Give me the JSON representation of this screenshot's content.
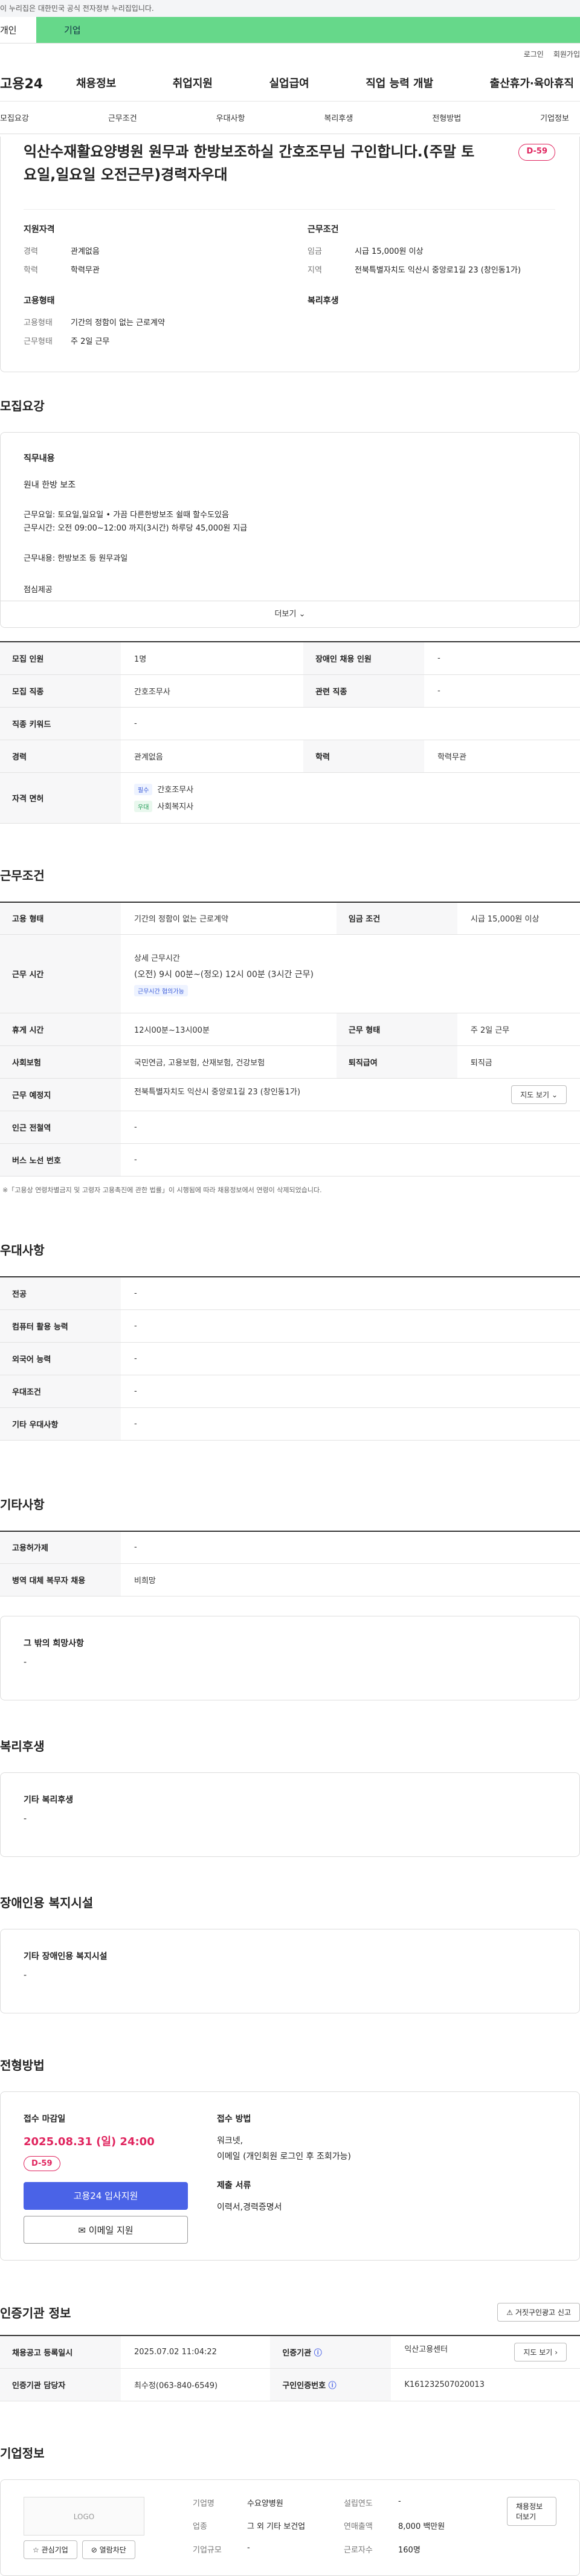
{
  "gov_bar": "이 누리집은 대한민국 공식 전자정부 누리집입니다.",
  "tabs": {
    "person": "개인",
    "company": "기업"
  },
  "util": {
    "login": "로그인",
    "join": "회원가입"
  },
  "logo": "고용24",
  "gnb": [
    "채용정보",
    "취업지원",
    "실업급여",
    "직업 능력 개발",
    "출산휴가·육아휴직"
  ],
  "anchors": [
    "모집요강",
    "근무조건",
    "우대사항",
    "복리후생",
    "전형방법",
    "기업정보"
  ],
  "title": "익산수재활요양병원 원무과 한방보조하실 간호조무님 구인합니다.(주말 토요일,일요일 오전근무)경력자우대",
  "dday": "D-59",
  "summary": {
    "qual_title": "지원자격",
    "qual": [
      {
        "k": "경력",
        "v": "관계없음"
      },
      {
        "k": "학력",
        "v": "학력무관"
      }
    ],
    "cond_title": "근무조건",
    "cond": [
      {
        "k": "임금",
        "v": "시급 15,000원 이상"
      },
      {
        "k": "지역",
        "v": "전북특별자치도 익산시 중앙로1길 23 (창인동1가)"
      }
    ],
    "emp_title": "고용형태",
    "emp": [
      {
        "k": "고용형태",
        "v": "기간의 정함이 없는 근로계약"
      },
      {
        "k": "근무형태",
        "v": "주 2일 근무"
      }
    ],
    "welfare_title": "복리후생"
  },
  "recruit": {
    "section": "모집요강",
    "duty_title": "직무내용",
    "duty_lines": [
      "원내 한방 보조",
      "",
      "근무요일: 토요일,일요일  • 가끔 다른한방보조 쉴때 할수도있음",
      "근무시간: 오전 09:00~12:00 까지(3시간)  하루당 45,000원 지급",
      "",
      "근무내용: 한방보조   등 원무과일",
      "",
      "점심제공"
    ],
    "more": "더보기",
    "rows": {
      "count_k": "모집 인원",
      "count_v": "1명",
      "disabled_k": "장애인 채용 인원",
      "disabled_v": "-",
      "job_k": "모집 직종",
      "job_v": "간호조무사",
      "rel_k": "관련 직종",
      "rel_v": "-",
      "kw_k": "직종 키워드",
      "kw_v": "-",
      "career_k": "경력",
      "career_v": "관계없음",
      "edu_k": "학력",
      "edu_v": "학력무관",
      "lic_k": "자격 면허",
      "lic": [
        {
          "badge": "필수",
          "name": "간호조무사"
        },
        {
          "badge": "우대",
          "name": "사회복지사"
        }
      ]
    }
  },
  "work": {
    "section": "근무조건",
    "emp_k": "고용 형태",
    "emp_v": "기간의 정함이 없는 근로계약",
    "wage_k": "임금 조건",
    "wage_v": "시급 15,000원 이상",
    "time_k": "근무 시간",
    "time_head": "상세 근무시간",
    "time_v": "(오전) 9시 00분~(정오) 12시 00분  (3시간 근무)",
    "time_badge": "근무시간 협의가능",
    "rest_k": "휴게 시간",
    "rest_v": "12시00분~13시00분",
    "form_k": "근무 형태",
    "form_v": "주 2일 근무",
    "ins_k": "사회보험",
    "ins_v": "국민연금, 고용보험, 산재보험, 건강보험",
    "ret_k": "퇴직급여",
    "ret_v": "퇴직금",
    "loc_k": "근무 예정지",
    "loc_v": "전북특별자치도 익산시 중앙로1길 23 (창인동1가)",
    "map_btn": "지도 보기",
    "sub_k": "인근 전철역",
    "sub_v": "-",
    "bus_k": "버스 노선 번호",
    "bus_v": "-",
    "note": "※「고용상 연령차별금지 및 고령자 고용촉진에 관한 법률」이 시행됨에 따라 채용정보에서 연령이 삭제되었습니다."
  },
  "pref": {
    "section": "우대사항",
    "rows": [
      {
        "k": "전공",
        "v": "-"
      },
      {
        "k": "컴퓨터 활용 능력",
        "v": "-"
      },
      {
        "k": "외국어 능력",
        "v": "-"
      },
      {
        "k": "우대조건",
        "v": "-"
      },
      {
        "k": "기타 우대사항",
        "v": "-"
      }
    ]
  },
  "etc": {
    "section": "기타사항",
    "rows": [
      {
        "k": "고용허가제",
        "v": "-"
      },
      {
        "k": "병역 대체 복무자 채용",
        "v": "비희망"
      }
    ],
    "wish_title": "그 밖의 희망사항",
    "wish_v": "-"
  },
  "welfare": {
    "section": "복리후생",
    "title": "기타 복리후생",
    "v": "-"
  },
  "disabled": {
    "section": "장애인용 복지시설",
    "title": "기타 장애인용 복지시설",
    "v": "-"
  },
  "apply": {
    "section": "전형방법",
    "deadline_title": "접수 마감일",
    "deadline": "2025.08.31 (일) 24:00",
    "dday": "D-59",
    "btn_apply": "고용24 입사지원",
    "btn_email": "이메일 지원",
    "method_title": "접수 방법",
    "methods": [
      "워크넷,",
      "이메일 (개인회원 로그인 후 조회가능)"
    ],
    "docs_title": "제출 서류",
    "docs": "이력서,경력증명서"
  },
  "cert": {
    "section": "인증기관 정보",
    "report_btn": "거짓구인광고 신고",
    "reg_k": "채용공고 등록일시",
    "reg_v": "2025.07.02 11:04:22",
    "org_k": "인증기관",
    "org_v": "익산고용센터",
    "map_btn": "지도 보기",
    "mgr_k": "인증기관 담당자",
    "mgr_v": "최수정(063-840-6549)",
    "num_k": "구인인증번호",
    "num_v": "K161232507020013"
  },
  "company": {
    "section": "기업정보",
    "logo": "LOGO",
    "fav_btn": "관심기업",
    "block_btn": "열람차단",
    "jobs_btn": "채용정보 더보기",
    "name_k": "기업명",
    "name_v": "수요양병원",
    "year_k": "설립연도",
    "year_v": "-",
    "ind_k": "업종",
    "ind_v": "그 외 기타 보건업",
    "sales_k": "연매출액",
    "sales_v": "8,000 백만원",
    "size_k": "기업규모",
    "size_v": "-",
    "emp_k": "근로자수",
    "emp_v": "160명"
  }
}
